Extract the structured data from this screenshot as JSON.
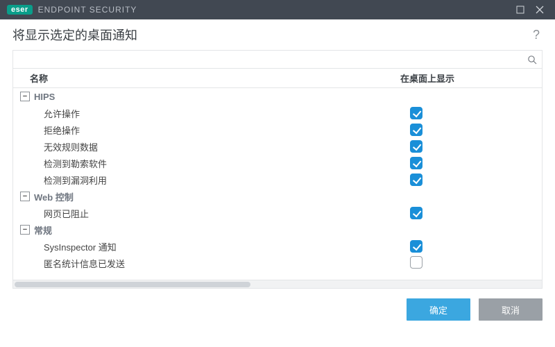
{
  "brand": {
    "badge": "eser",
    "product": "ENDPOINT SECURITY"
  },
  "page_title": "将显示选定的桌面通知",
  "search": {
    "value": ""
  },
  "columns": {
    "name": "名称",
    "show": "在桌面上显示"
  },
  "groups": [
    {
      "name": "HIPS",
      "items": [
        {
          "label": "允许操作",
          "checked": true
        },
        {
          "label": "拒绝操作",
          "checked": true
        },
        {
          "label": "无效规则数据",
          "checked": true
        },
        {
          "label": "检测到勒索软件",
          "checked": true
        },
        {
          "label": "检测到漏洞利用",
          "checked": true
        }
      ]
    },
    {
      "name": "Web 控制",
      "items": [
        {
          "label": "网页已阻止",
          "checked": true
        }
      ]
    },
    {
      "name": "常规",
      "items": [
        {
          "label": "SysInspector 通知",
          "checked": true
        },
        {
          "label": "匿名统计信息已发送",
          "checked": false
        }
      ]
    }
  ],
  "buttons": {
    "ok": "确定",
    "cancel": "取消"
  }
}
